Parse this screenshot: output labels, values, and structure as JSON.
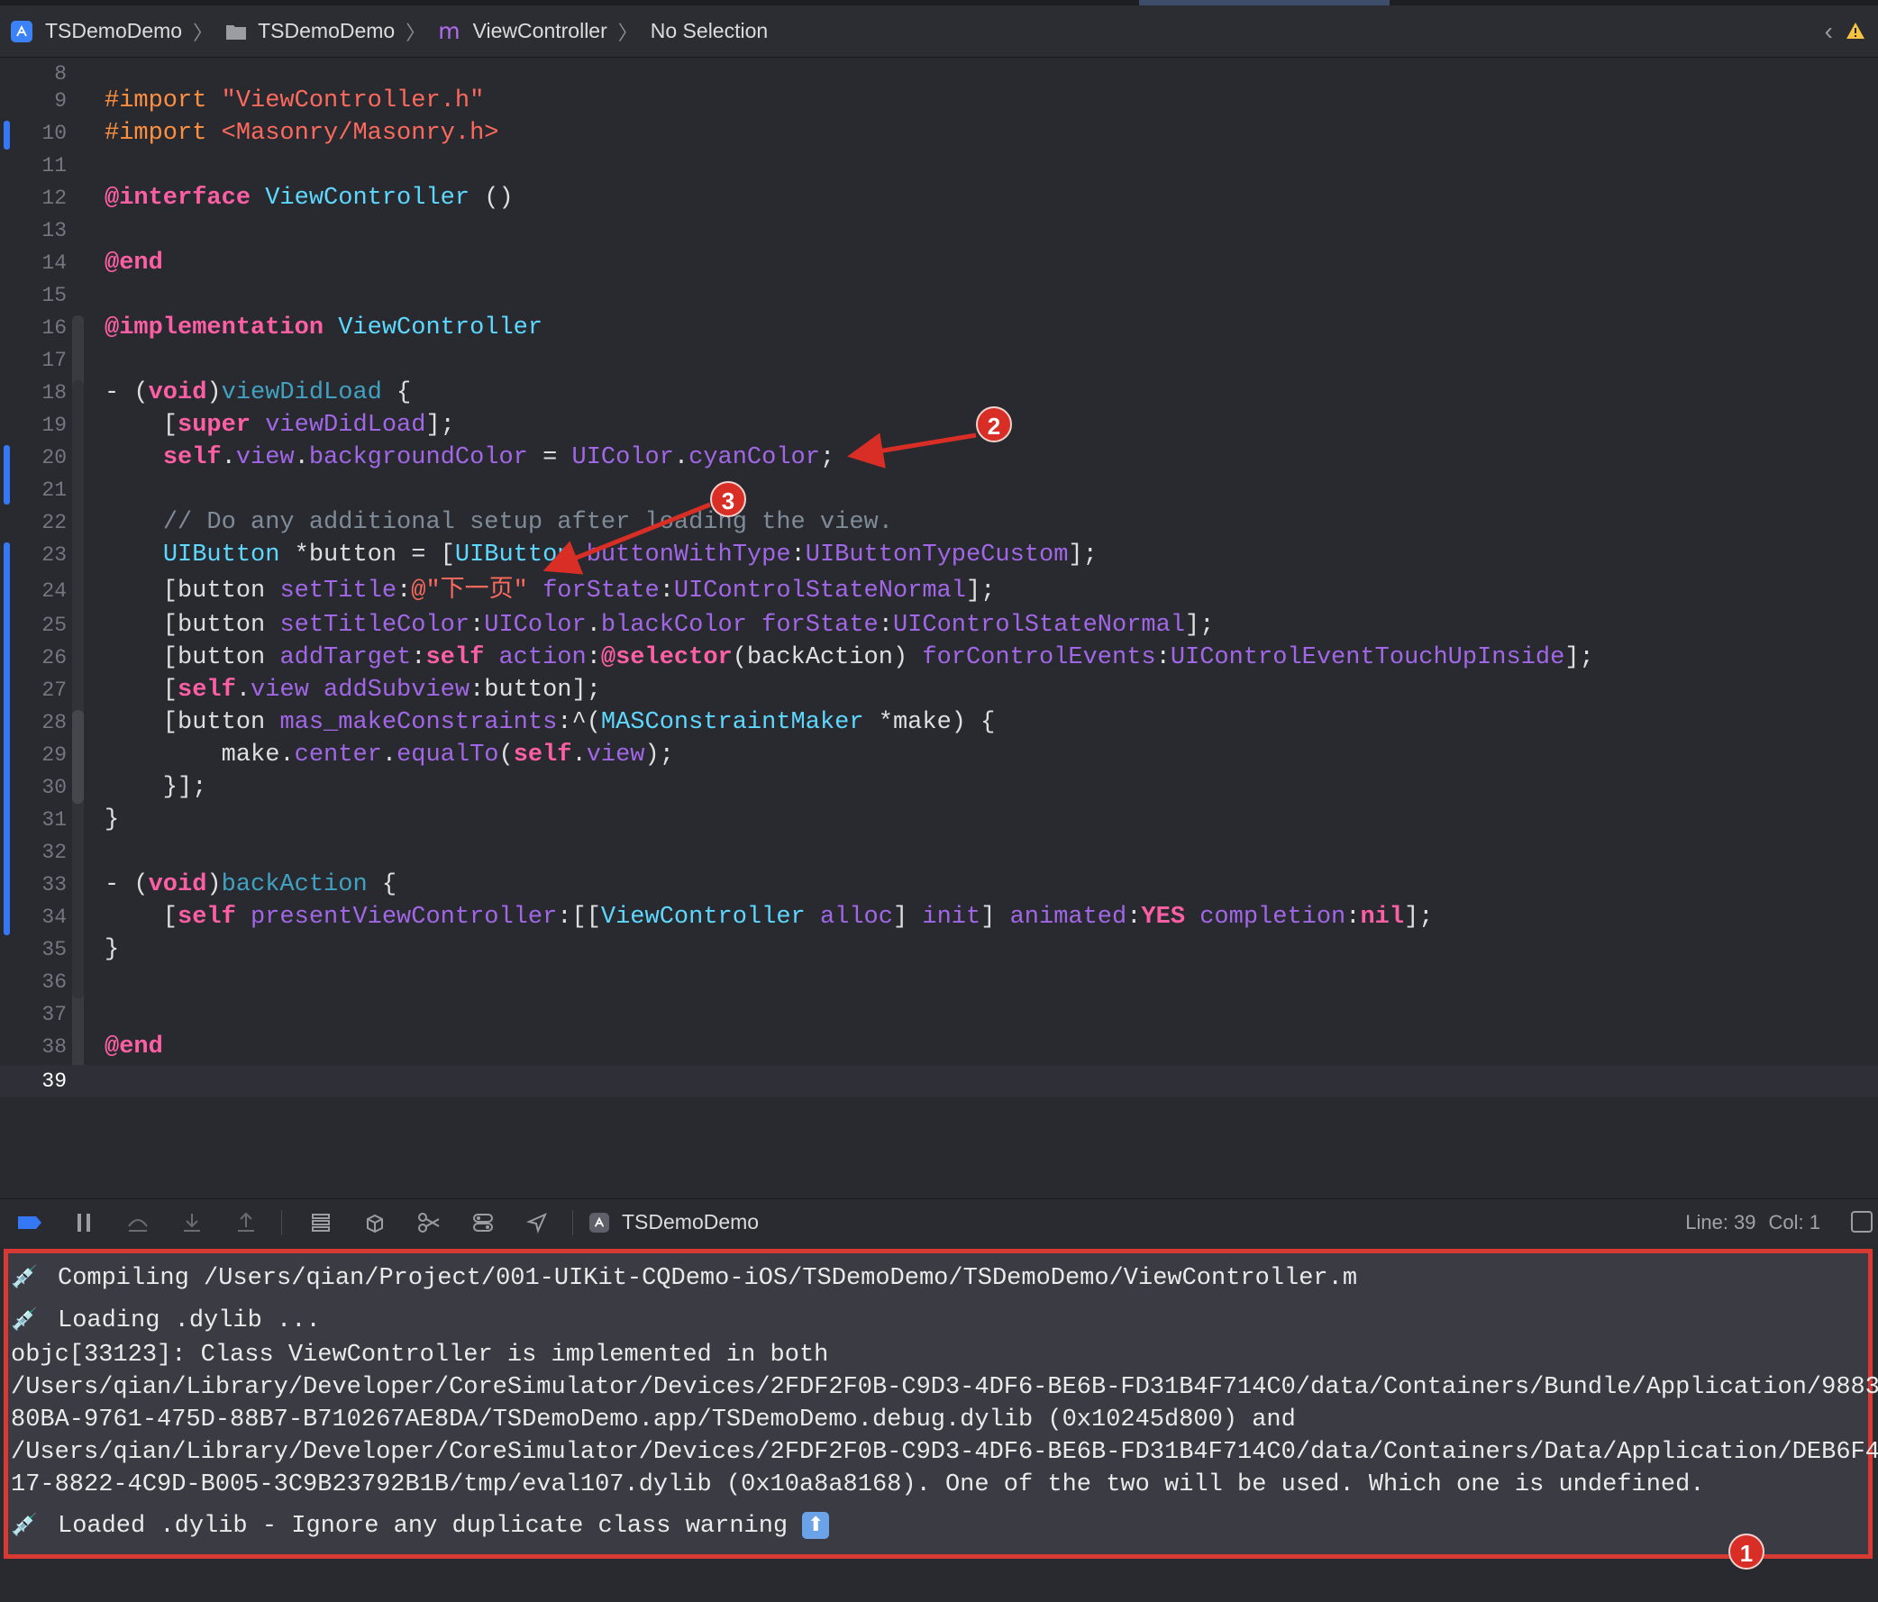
{
  "breadcrumb": {
    "project": "TSDemoDemo",
    "group": "TSDemoDemo",
    "file": "ViewController",
    "selection": "No Selection"
  },
  "editor": {
    "line_numbers": [
      "8",
      "9",
      "10",
      "11",
      "12",
      "13",
      "14",
      "15",
      "16",
      "17",
      "18",
      "19",
      "20",
      "21",
      "22",
      "23",
      "24",
      "25",
      "26",
      "27",
      "28",
      "29",
      "30",
      "31",
      "32",
      "33",
      "34",
      "35",
      "36",
      "37",
      "38",
      "39"
    ],
    "current_line": "39"
  },
  "debug_bar": {
    "scheme": "TSDemoDemo",
    "line_label": "Line: 39",
    "col_label": "Col: 1"
  },
  "console": {
    "lines": [
      "Compiling /Users/qian/Project/001-UIKit-CQDemo-iOS/TSDemoDemo/TSDemoDemo/ViewController.m",
      "Loading .dylib ...",
      "objc[33123]: Class ViewController is implemented in both",
      "/Users/qian/Library/Developer/CoreSimulator/Devices/2FDF2F0B-C9D3-4DF6-BE6B-FD31B4F714C0/data/Containers/Bundle/Application/9883",
      "80BA-9761-475D-88B7-B710267AE8DA/TSDemoDemo.app/TSDemoDemo.debug.dylib (0x10245d800) and",
      "/Users/qian/Library/Developer/CoreSimulator/Devices/2FDF2F0B-C9D3-4DF6-BE6B-FD31B4F714C0/data/Containers/Data/Application/DEB6F4",
      "17-8822-4C9D-B005-3C9B23792B1B/tmp/eval107.dylib (0x10a8a8168). One of the two will be used. Which one is undefined.",
      "Loaded .dylib - Ignore any duplicate class warning"
    ]
  },
  "annotations": {
    "badge1": "1",
    "badge2": "2",
    "badge3": "3",
    "color": "#d92e26"
  },
  "colors": {
    "keyword": "#fc5fa3",
    "preprocessor": "#fd8f3f",
    "string": "#fc6a5d",
    "class": "#5dd8ff",
    "method": "#a167e6",
    "comment": "#7f8c98",
    "console_border": "#d63a33"
  }
}
